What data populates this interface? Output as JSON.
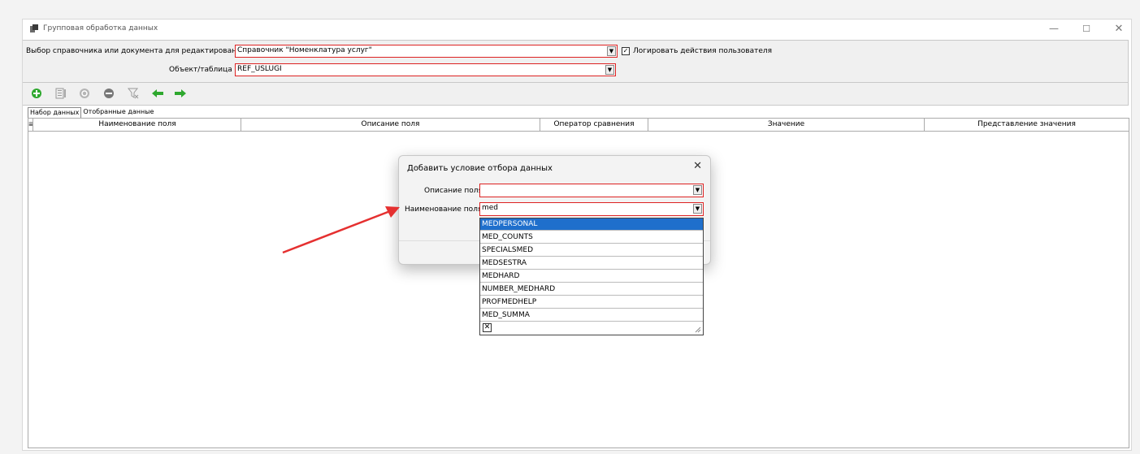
{
  "window": {
    "title": "Групповая обработка данных",
    "controls": {
      "minimize": "—",
      "maximize": "☐",
      "close": "✕"
    }
  },
  "form": {
    "directory_label": "Выбор справочника или документа для редактирования",
    "directory_value": "Справочник \"Номенклатура услуг\"",
    "log_checkbox_label": "Логировать действия пользователя",
    "log_checkbox_checked": true,
    "object_label": "Объект/таблица",
    "object_value": "REF_USLUGI"
  },
  "toolbar": {
    "icons": [
      "add-icon",
      "edit-icon",
      "refresh-icon",
      "remove-icon",
      "filter-clear-icon",
      "arrow-left-icon",
      "arrow-right-icon"
    ]
  },
  "tabs": [
    {
      "label": "Набор данных",
      "active": true
    },
    {
      "label": "Отобранные данные",
      "active": false
    }
  ],
  "grid": {
    "columns": [
      "Наименование поля",
      "Описание поля",
      "Оператор сравнения",
      "Значение",
      "Представление значения"
    ]
  },
  "dialog": {
    "title": "Добавить условие отбора данных",
    "close": "✕",
    "description_label": "Описание поля",
    "description_value": "",
    "field_name_label": "Наименование поля",
    "field_name_value": "med"
  },
  "dropdown": {
    "selected_index": 0,
    "items": [
      "MEDPERSONAL",
      "MED_COUNTS",
      "SPECIALSMED",
      "MEDSESTRA",
      "MEDHARD",
      "NUMBER_MEDHARD",
      "PROFMEDHELP",
      "MED_SUMMA"
    ],
    "clear_glyph": "✕"
  },
  "colors": {
    "highlight_border": "#dd2222",
    "selection": "#1f6fcc",
    "annotation_arrow": "#e53030",
    "toolbar_green": "#2ea82e"
  }
}
